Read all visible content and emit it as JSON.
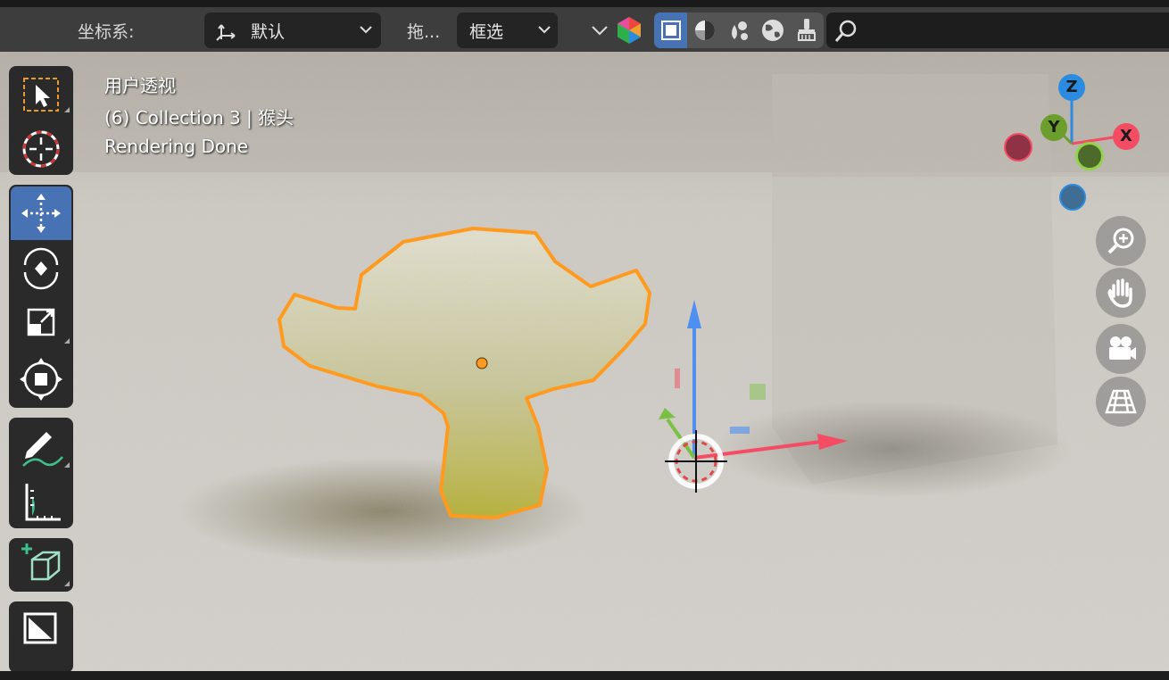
{
  "header": {
    "coord_label": "坐标系:",
    "orientation_value": "默认",
    "drag_label": "拖...",
    "select_value": "框选",
    "search_placeholder": ""
  },
  "viewport": {
    "view_name": "用户透视",
    "collection_info": "(6) Collection 3 | 猴头",
    "status": "Rendering Done"
  },
  "gizmo": {
    "z": "Z",
    "y": "Y",
    "x": "X"
  },
  "toolbar": {
    "tools": [
      "select-box",
      "cursor",
      "move",
      "rotate",
      "scale",
      "transform",
      "annotate",
      "measure",
      "add-cube",
      "last-tool"
    ],
    "active_tool": "move"
  },
  "navigation": [
    "zoom",
    "pan",
    "camera",
    "perspective-toggle"
  ],
  "colors": {
    "header_bg": "#3d3d3d",
    "dropdown_bg": "#242424",
    "active_blue": "#4772b3",
    "selection_outline": "#ff9a1e",
    "axis_x": "#f44c63",
    "axis_y": "#6b9e2c",
    "axis_z": "#2a8be0"
  }
}
